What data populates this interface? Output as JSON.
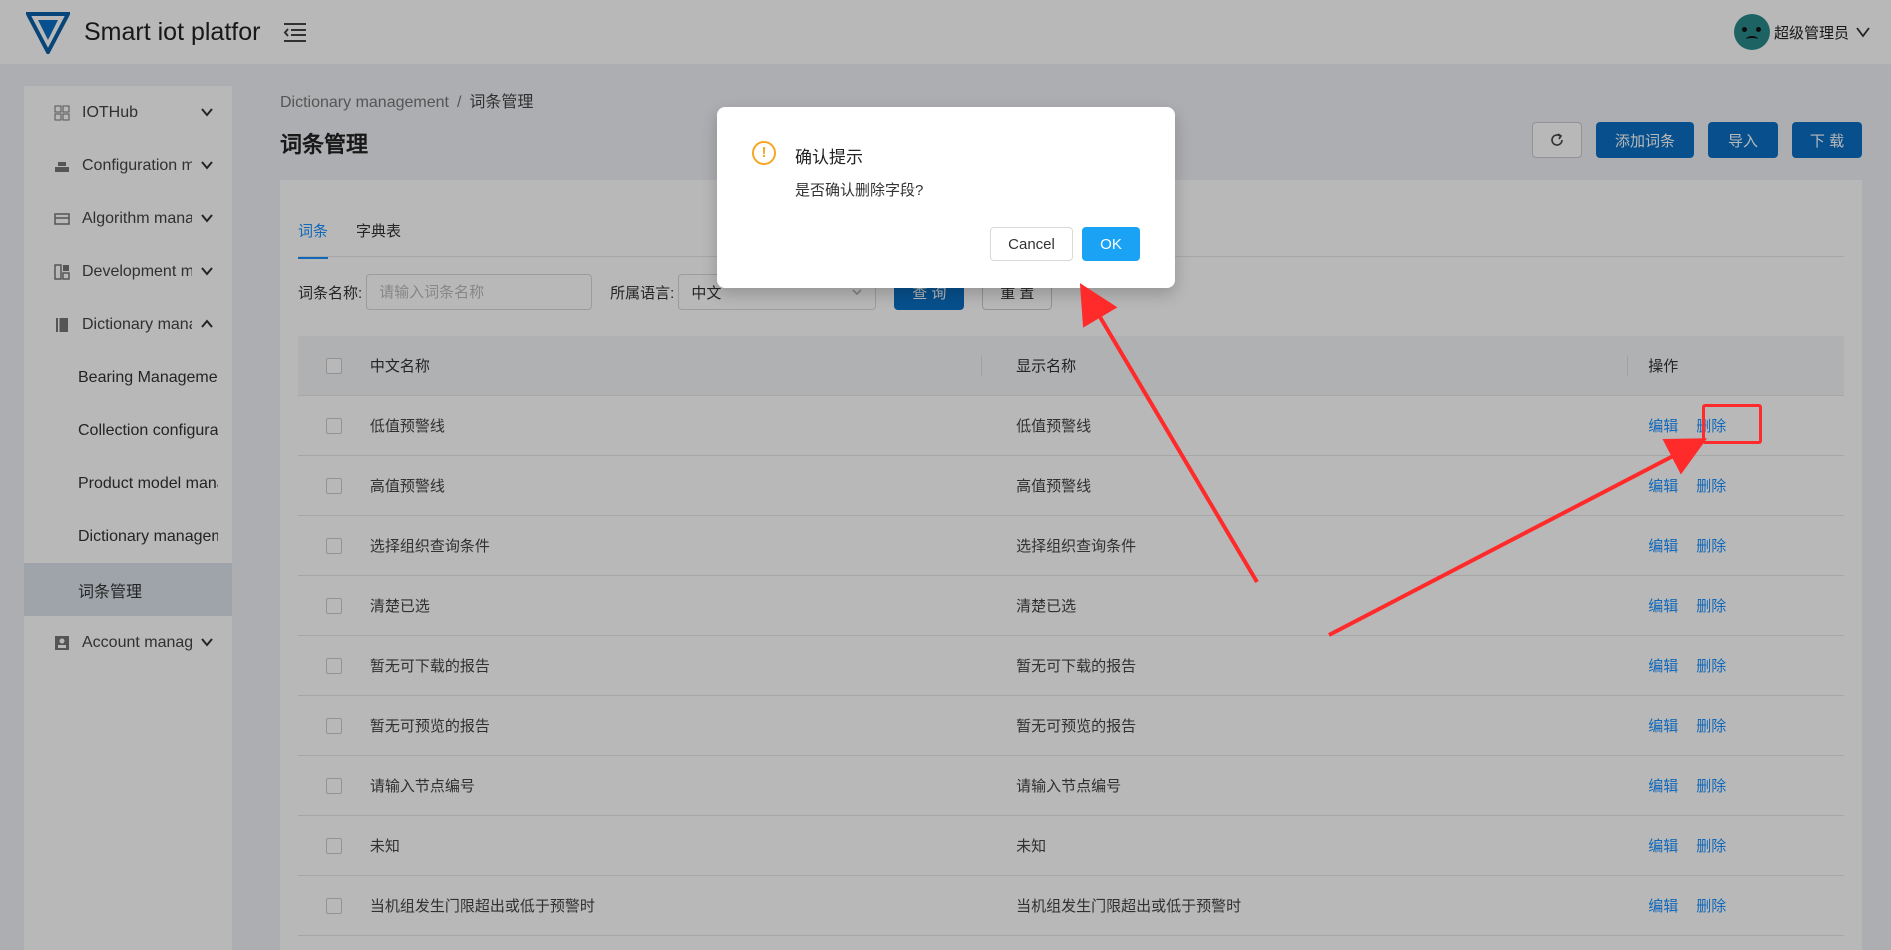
{
  "app": {
    "title": "Smart iot platform"
  },
  "user": {
    "name": "超级管理员"
  },
  "sidebar": {
    "items": [
      {
        "label": "IOTHub",
        "icon": "grid-icon",
        "expanded": false
      },
      {
        "label": "Configuration management",
        "icon": "layers-icon",
        "expanded": false
      },
      {
        "label": "Algorithm management",
        "icon": "algorithm-icon",
        "expanded": false
      },
      {
        "label": "Development management",
        "icon": "dev-icon",
        "expanded": false
      },
      {
        "label": "Dictionary management",
        "icon": "book-icon",
        "expanded": true
      },
      {
        "label": "Account management",
        "icon": "account-icon",
        "expanded": false
      }
    ],
    "subitems": [
      {
        "label": "Bearing Management"
      },
      {
        "label": "Collection configuration"
      },
      {
        "label": "Product model management"
      },
      {
        "label": "Dictionary management"
      },
      {
        "label": "词条管理",
        "active": true
      }
    ]
  },
  "breadcrumb": {
    "parent": "Dictionary management",
    "separator": "/",
    "current": "词条管理"
  },
  "page": {
    "title": "词条管理"
  },
  "toolbar": {
    "add_label": "添加词条",
    "import_label": "导入",
    "download_label": "下 载"
  },
  "tabs": [
    {
      "label": "词条",
      "active": true
    },
    {
      "label": "字典表",
      "active": false
    }
  ],
  "filter": {
    "name_label": "词条名称:",
    "name_placeholder": "请输入词条名称",
    "lang_label": "所属语言:",
    "lang_value": "中文",
    "search_label": "查 询",
    "reset_label": "重 置"
  },
  "table": {
    "columns": [
      "中文名称",
      "显示名称",
      "操作"
    ],
    "edit_label": "编辑",
    "delete_label": "删除",
    "rows": [
      {
        "cn": "低值预警线",
        "display": "低值预警线"
      },
      {
        "cn": "高值预警线",
        "display": "高值预警线"
      },
      {
        "cn": "选择组织查询条件",
        "display": "选择组织查询条件"
      },
      {
        "cn": "清楚已选",
        "display": "清楚已选"
      },
      {
        "cn": "暂无可下载的报告",
        "display": "暂无可下载的报告"
      },
      {
        "cn": "暂无可预览的报告",
        "display": "暂无可预览的报告"
      },
      {
        "cn": "请输入节点编号",
        "display": "请输入节点编号"
      },
      {
        "cn": "未知",
        "display": "未知"
      },
      {
        "cn": "当机组发生门限超出或低于预警时",
        "display": "当机组发生门限超出或低于预警时"
      }
    ]
  },
  "modal": {
    "title": "确认提示",
    "content": "是否确认删除字段?",
    "cancel_label": "Cancel",
    "ok_label": "OK",
    "icon": "warning-icon"
  },
  "colors": {
    "primary": "#0b70c4",
    "link": "#1890ff",
    "ok": "#1aa3f5",
    "warning": "#f5a623",
    "annotation": "#ff2a2a"
  }
}
